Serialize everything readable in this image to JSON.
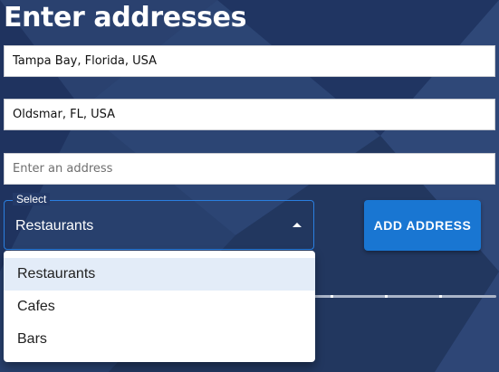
{
  "page": {
    "title": "Enter addresses"
  },
  "addresses": [
    {
      "value": "Tampa Bay, Florida, USA",
      "placeholder": ""
    },
    {
      "value": "Oldsmar, FL, USA",
      "placeholder": ""
    },
    {
      "value": "",
      "placeholder": "Enter an address"
    }
  ],
  "category_select": {
    "label": "Select",
    "value": "Restaurants",
    "options": [
      "Restaurants",
      "Cafes",
      "Bars"
    ],
    "highlighted_option": "Restaurants"
  },
  "add_button": {
    "label": "ADD ADDRESS"
  },
  "colors": {
    "background": "#243a68",
    "accent": "#1976d2",
    "select_border": "#2a7fe0",
    "option_highlight": "#e3ecf8"
  }
}
